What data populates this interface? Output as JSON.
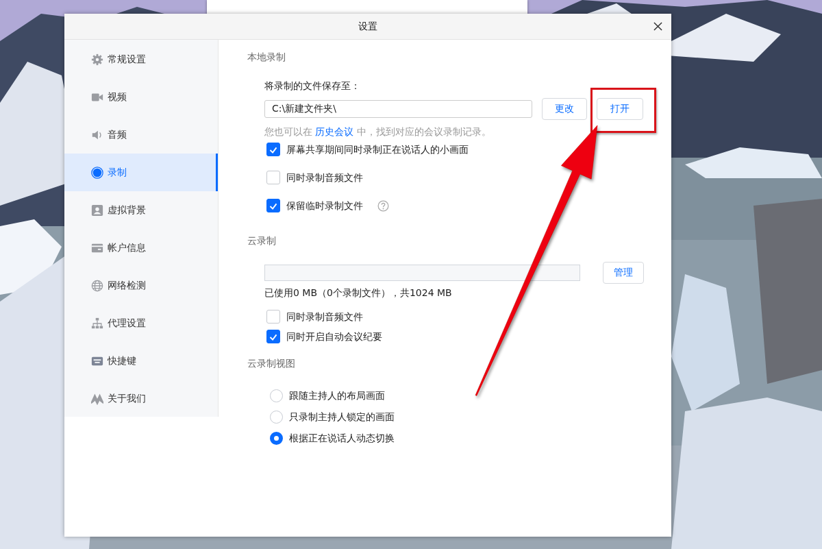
{
  "window": {
    "title": "设置"
  },
  "sidebar": {
    "items": [
      {
        "label": "常规设置",
        "kind": "gear",
        "selected": false
      },
      {
        "label": "视频",
        "kind": "camera",
        "selected": false
      },
      {
        "label": "音频",
        "kind": "speaker",
        "selected": false
      },
      {
        "label": "录制",
        "kind": "record",
        "selected": true
      },
      {
        "label": "虚拟背景",
        "kind": "person",
        "selected": false
      },
      {
        "label": "帐户信息",
        "kind": "card",
        "selected": false
      },
      {
        "label": "网络检测",
        "kind": "globe",
        "selected": false
      },
      {
        "label": "代理设置",
        "kind": "network",
        "selected": false
      },
      {
        "label": "快捷键",
        "kind": "keyboard",
        "selected": false
      },
      {
        "label": "关于我们",
        "kind": "logo",
        "selected": false
      }
    ]
  },
  "local_recording": {
    "heading": "本地录制",
    "save_label": "将录制的文件保存至：",
    "path": "C:\\新建文件夹\\",
    "buttons": [
      "更改",
      "打开"
    ],
    "hint": {
      "before": "您也可以在 ",
      "link": "历史会议",
      "after": " 中，找到对应的会议录制记录。"
    },
    "options": [
      {
        "label": "屏幕共享期间同时录制正在说话人的小画面",
        "checked": true,
        "help": false
      },
      {
        "label": "同时录制音频文件",
        "checked": false,
        "help": false
      },
      {
        "label": "保留临时录制文件",
        "checked": true,
        "help": true
      }
    ]
  },
  "cloud_recording": {
    "heading": "云录制",
    "manage_button": "管理",
    "usage": "已使用0 MB（0个录制文件），共1024 MB",
    "options": [
      {
        "label": "同时录制音频文件",
        "checked": false
      },
      {
        "label": "同时开启自动会议纪要",
        "checked": true
      }
    ]
  },
  "cloud_view": {
    "heading": "云录制视图",
    "options": [
      {
        "label": "跟随主持人的布局画面",
        "selected": false
      },
      {
        "label": "只录制主持人锁定的画面",
        "selected": false
      },
      {
        "label": "根据正在说话人动态切换",
        "selected": true
      }
    ]
  }
}
